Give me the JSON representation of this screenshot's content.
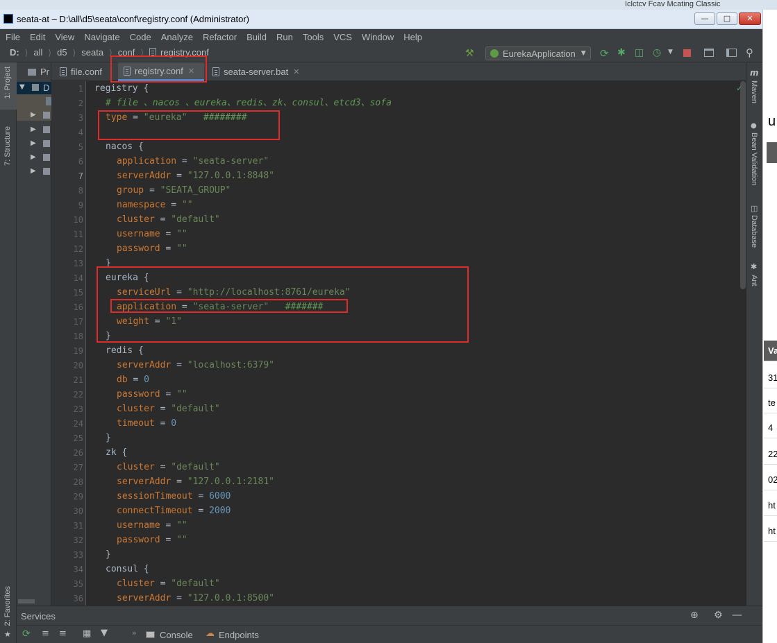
{
  "window": {
    "title": "seata-at – D:\\all\\d5\\seata\\conf\\registry.conf (Administrator)"
  },
  "background_text": "Iclctcv Fcav Mcating Classic",
  "menu": [
    "File",
    "Edit",
    "View",
    "Navigate",
    "Code",
    "Analyze",
    "Refactor",
    "Build",
    "Run",
    "Tools",
    "VCS",
    "Window",
    "Help"
  ],
  "breadcrumb": [
    "D:",
    "all",
    "d5",
    "seata",
    "conf",
    "registry.conf"
  ],
  "run_config": "EurekaApplication",
  "left_tools": {
    "project": "1: Project",
    "structure": "7: Structure",
    "favorites": "2: Favorites"
  },
  "project_panel": {
    "root": "D",
    "tab_label": "Pr"
  },
  "tabs": [
    {
      "label": "file.conf",
      "active": false
    },
    {
      "label": "registry.conf",
      "active": true
    },
    {
      "label": "seata-server.bat",
      "active": false
    }
  ],
  "right_tools": {
    "maven": "Maven",
    "bean": "Bean Validation",
    "database": "Database",
    "ant": "Ant"
  },
  "maven_glyph": "m",
  "services": {
    "title": "Services",
    "console": "Console",
    "endpoints": "Endpoints"
  },
  "overflow_column": [
    "u",
    "Va",
    "31",
    "te",
    "4",
    "22",
    "02",
    "ht",
    "ht"
  ],
  "code": {
    "line_numbers": [
      "1",
      "2",
      "3",
      "4",
      "5",
      "6",
      "7",
      "8",
      "9",
      "10",
      "11",
      "12",
      "13",
      "14",
      "15",
      "16",
      "17",
      "18",
      "19",
      "20",
      "21",
      "22",
      "23",
      "24",
      "25",
      "26",
      "27",
      "28",
      "29",
      "30",
      "31",
      "32",
      "33",
      "34",
      "35",
      "36"
    ],
    "l1": "registry {",
    "l2": "# file 、nacos 、eureka、redis、zk、consul、etcd3、sofa",
    "l3_key": "type",
    "l3_val": "\"eureka\"",
    "l3_comment": "########",
    "l5": "nacos {",
    "l6_key": "application",
    "l6_val": "\"seata-server\"",
    "l7_key": "serverAddr",
    "l7_val": "\"127.0.0.1:8848\"",
    "l8_key": "group",
    "l8_val": "\"SEATA_GROUP\"",
    "l9_key": "namespace",
    "l9_val": "\"\"",
    "l10_key": "cluster",
    "l10_val": "\"default\"",
    "l11_key": "username",
    "l11_val": "\"\"",
    "l12_key": "password",
    "l12_val": "\"\"",
    "l13": "}",
    "l14": "eureka {",
    "l15_key": "serviceUrl",
    "l15_val": "\"http://localhost:8761/eureka\"",
    "l16_key": "application",
    "l16_val": "\"seata-server\"",
    "l16_comment": "#######",
    "l17_key": "weight",
    "l17_val": "\"1\"",
    "l18": "}",
    "l19": "redis {",
    "l20_key": "serverAddr",
    "l20_val": "\"localhost:6379\"",
    "l21_key": "db",
    "l21_val": "0",
    "l22_key": "password",
    "l22_val": "\"\"",
    "l23_key": "cluster",
    "l23_val": "\"default\"",
    "l24_key": "timeout",
    "l24_val": "0",
    "l25": "}",
    "l26": "zk {",
    "l27_key": "cluster",
    "l27_val": "\"default\"",
    "l28_key": "serverAddr",
    "l28_val": "\"127.0.0.1:2181\"",
    "l29_key": "sessionTimeout",
    "l29_val": "6000",
    "l30_key": "connectTimeout",
    "l30_val": "2000",
    "l31_key": "username",
    "l31_val": "\"\"",
    "l32_key": "password",
    "l32_val": "\"\"",
    "l33": "}",
    "l34": "consul {",
    "l35_key": "cluster",
    "l35_val": "\"default\"",
    "l36_key": "serverAddr",
    "l36_val": "\"127.0.0.1:8500\""
  },
  "colors": {
    "keyword": "#cc7832",
    "string": "#6a8759",
    "comment": "#629755",
    "number": "#6897bb",
    "annotation_box": "#e02b2b"
  }
}
